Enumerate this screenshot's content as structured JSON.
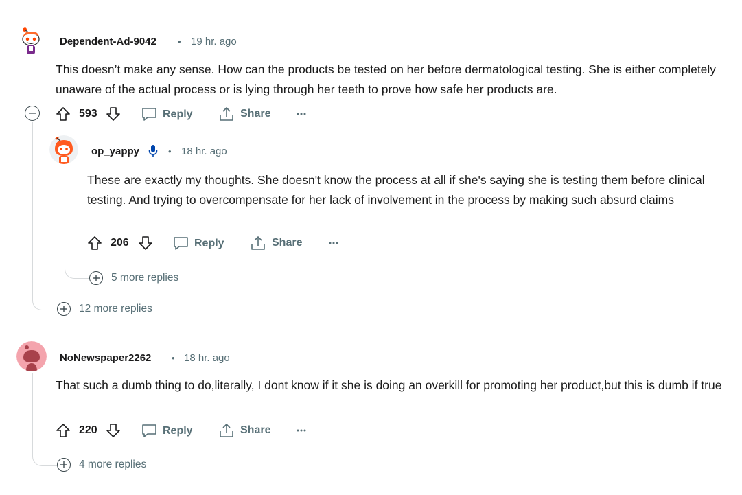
{
  "comments": [
    {
      "author": "Dependent-Ad-9042",
      "separator": "•",
      "time": "19 hr. ago",
      "body": "This doesn’t make any sense. How can the products be tested on her before dermatological testing. She is either completely unaware of the actual process or is lying through her teeth to prove how safe her products are.",
      "score": "593",
      "reply_label": "Reply",
      "share_label": "Share",
      "more_replies": "12 more replies",
      "replies": [
        {
          "author": "op_yappy",
          "separator": "•",
          "time": "18 hr. ago",
          "body": "These are exactly my thoughts. She doesn't know the process at all if she's saying she is testing them before clinical testing. And trying to overcompensate for her lack of involvement in the process by making such absurd claims",
          "score": "206",
          "reply_label": "Reply",
          "share_label": "Share",
          "more_replies": "5 more replies",
          "badge_icon": "microphone-icon"
        }
      ]
    },
    {
      "author": "NoNewspaper2262",
      "separator": "•",
      "time": "18 hr. ago",
      "body": "That such a dumb thing to do,literally, I dont know if it she is doing an overkill for promoting her product,but this is dumb if true",
      "score": "220",
      "reply_label": "Reply",
      "share_label": "Share",
      "more_replies": "4 more replies"
    }
  ],
  "colors": {
    "muted": "#576f76",
    "thread_line": "#d7dadc",
    "op_badge": "#0045ac",
    "avatar_pink": "#f4a4ad",
    "snoo_orange": "#ff4500"
  }
}
